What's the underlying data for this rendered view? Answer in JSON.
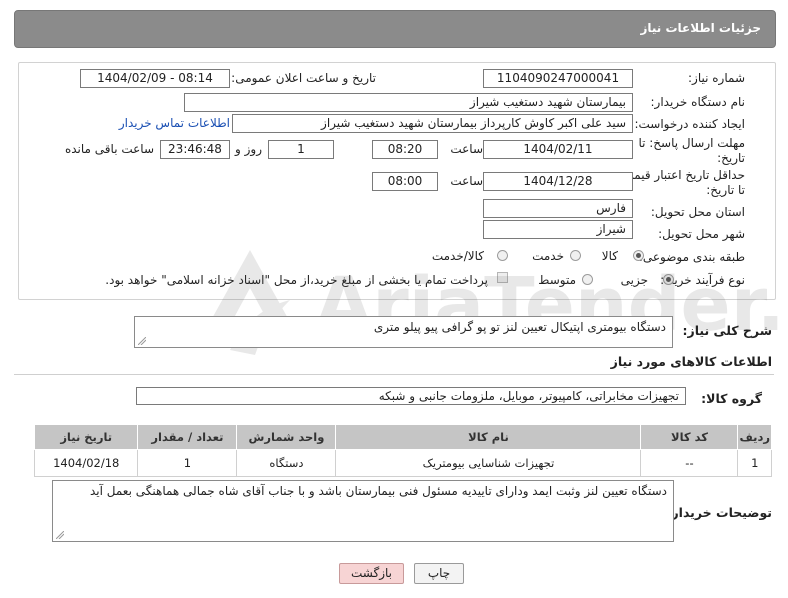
{
  "header": {
    "title": "جزئیات اطلاعات نیاز"
  },
  "form": {
    "need_number_label": "شماره نیاز:",
    "need_number": "1104090247000041",
    "announce_label": "تاریخ و ساعت اعلان عمومی:",
    "announce_value": "1404/02/09 - 08:14",
    "buyer_org_label": "نام دستگاه خریدار:",
    "buyer_org": "بیمارستان شهید دستغیب شیراز",
    "creator_label": "ایجاد کننده درخواست:",
    "creator": "سید علی اکبر کاوش کارپرداز بیمارستان شهید دستغیب شیراز",
    "contact_link": "اطلاعات تماس خریدار",
    "deadline_label_1": "مهلت ارسال پاسخ: تا",
    "deadline_label_2": "تاریخ:",
    "deadline_date": "1404/02/11",
    "time_label": "ساعت",
    "deadline_time": "08:20",
    "days_value": "1",
    "days_label": "روز و",
    "remaining_time": "23:46:48",
    "remaining_label": "ساعت باقی مانده",
    "min_price_label_1": "حداقل تاریخ اعتبار قیمت:",
    "min_price_label_2": "تا تاریخ:",
    "price_date": "1404/12/28",
    "price_time": "08:00",
    "province_label": "استان محل تحویل:",
    "province": "فارس",
    "city_label": "شهر محل تحویل:",
    "city": "شیراز",
    "category_label": "طبقه بندی موضوعی:",
    "category_options": [
      "کالا",
      "خدمت",
      "کالا/خدمت"
    ],
    "process_label": "نوع فرآیند خرید :",
    "process_options": [
      "جزیی",
      "متوسط"
    ],
    "payment_note": "پرداخت تمام یا بخشی از مبلغ خرید،از محل \"اسناد خزانه اسلامی\" خواهد بود."
  },
  "description": {
    "label": "شرح کلی نیاز:",
    "text": "دستگاه بیومتری اپتیکال تعیین لنز  تو پو گرافی پیو پیلو متری"
  },
  "goods": {
    "section_title": "اطلاعات کالاهای مورد نیاز",
    "group_label": "گروه کالا:",
    "group_value": "تجهیزات مخابراتی، کامپیوتر، موبایل، ملزومات جانبی و شبکه",
    "columns": [
      "ردیف",
      "کد کالا",
      "نام کالا",
      "واحد شمارش",
      "تعداد / مقدار",
      "تاریخ نیاز"
    ],
    "rows": [
      [
        "1",
        "--",
        "تجهیزات شناسایی بیومتریک",
        "دستگاه",
        "1",
        "1404/02/18"
      ]
    ]
  },
  "buyer_notes": {
    "label": "توضیحات خریدار:",
    "text": "دستگاه تعیین لنز وثبت ایمد ودارای تاییدیه مسئول فنی بیمارستان باشد و با جناب آقای شاه جمالی هماهنگی بعمل آید"
  },
  "buttons": {
    "print": "چاپ",
    "back": "بازگشت"
  },
  "watermark": {
    "text": "AriaTender.net"
  },
  "colors": {
    "header_bg": "#8b8b8b",
    "link": "#1a4fb3",
    "table_header": "#c5c5c5",
    "back_button": "#f7d4d4"
  }
}
